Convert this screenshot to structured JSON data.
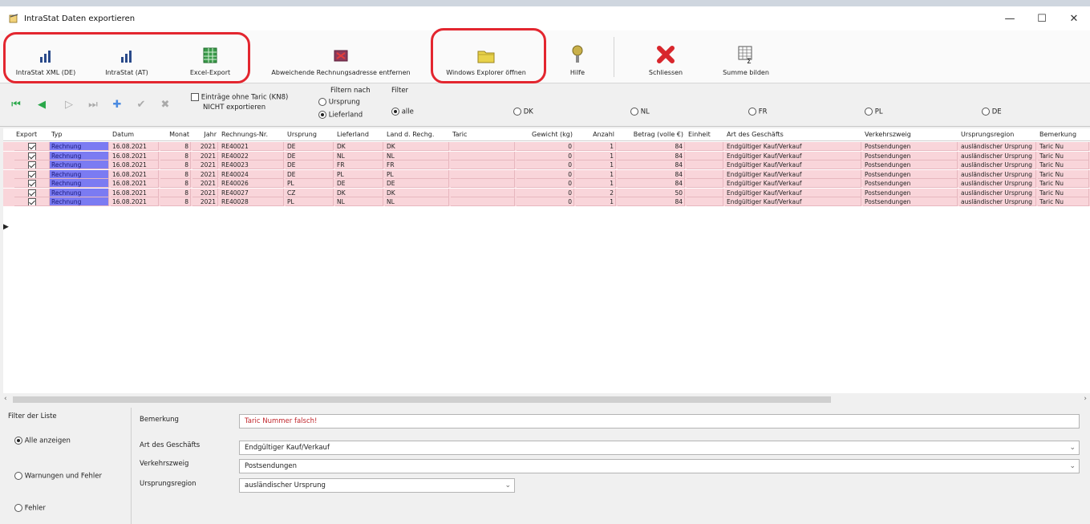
{
  "window": {
    "title": "IntraStat Daten exportieren",
    "minimize": "—",
    "maximize": "☐",
    "close": "✕"
  },
  "toolbar": {
    "buttons": [
      {
        "label": "IntraStat XML (DE)",
        "icon": "bar-chart-icon"
      },
      {
        "label": "IntraStat (AT)",
        "icon": "bar-chart-icon"
      },
      {
        "label": "Excel-Export",
        "icon": "spreadsheet-icon"
      },
      {
        "label": "Abweichende Rechnungsadresse entfernen",
        "icon": "card-remove-icon"
      },
      {
        "label": "Windows Explorer öffnen",
        "icon": "folder-icon"
      },
      {
        "label": "Hilfe",
        "icon": "help-icon"
      },
      {
        "label": "Schliessen",
        "icon": "close-icon"
      },
      {
        "label": "Summe bilden",
        "icon": "sum-table-icon"
      }
    ]
  },
  "filterbar": {
    "no_taric_line1": "Einträge ohne Taric (KN8)",
    "no_taric_line2": "NICHT exportieren",
    "filter_by_title": "Filtern nach",
    "filter_by_origin": "Ursprung",
    "filter_by_supplier": "Lieferland",
    "filter_title": "Filter",
    "countries": [
      "alle",
      "DK",
      "NL",
      "FR",
      "PL",
      "DE"
    ],
    "selected_country": "alle"
  },
  "table": {
    "columns": [
      "Export",
      "Typ",
      "Datum",
      "Monat",
      "Jahr",
      "Rechnungs-Nr.",
      "Ursprung",
      "Lieferland",
      "Land d. Rechg.",
      "Taric",
      "Gewicht (kg)",
      "Anzahl",
      "Betrag (volle €)",
      "Einheit",
      "Art des Geschäfts",
      "Verkehrszweig",
      "Ursprungsregion",
      "Bemerkung"
    ],
    "rows": [
      [
        "✓",
        "Rechnung",
        "16.08.2021",
        "8",
        "2021",
        "RE40021",
        "DE",
        "DK",
        "DK",
        "",
        "0",
        "1",
        "84",
        "",
        "Endgültiger Kauf/Verkauf",
        "Postsendungen",
        "ausländischer Ursprung",
        "Taric Nu"
      ],
      [
        "✓",
        "Rechnung",
        "16.08.2021",
        "8",
        "2021",
        "RE40022",
        "DE",
        "NL",
        "NL",
        "",
        "0",
        "1",
        "84",
        "",
        "Endgültiger Kauf/Verkauf",
        "Postsendungen",
        "ausländischer Ursprung",
        "Taric Nu"
      ],
      [
        "✓",
        "Rechnung",
        "16.08.2021",
        "8",
        "2021",
        "RE40023",
        "DE",
        "FR",
        "FR",
        "",
        "0",
        "1",
        "84",
        "",
        "Endgültiger Kauf/Verkauf",
        "Postsendungen",
        "ausländischer Ursprung",
        "Taric Nu"
      ],
      [
        "✓",
        "Rechnung",
        "16.08.2021",
        "8",
        "2021",
        "RE40024",
        "DE",
        "PL",
        "PL",
        "",
        "0",
        "1",
        "84",
        "",
        "Endgültiger Kauf/Verkauf",
        "Postsendungen",
        "ausländischer Ursprung",
        "Taric Nu"
      ],
      [
        "✓",
        "Rechnung",
        "16.08.2021",
        "8",
        "2021",
        "RE40026",
        "PL",
        "DE",
        "DE",
        "",
        "0",
        "1",
        "84",
        "",
        "Endgültiger Kauf/Verkauf",
        "Postsendungen",
        "ausländischer Ursprung",
        "Taric Nu"
      ],
      [
        "✓",
        "Rechnung",
        "16.08.2021",
        "8",
        "2021",
        "RE40027",
        "CZ",
        "DK",
        "DK",
        "",
        "0",
        "2",
        "50",
        "",
        "Endgültiger Kauf/Verkauf",
        "Postsendungen",
        "ausländischer Ursprung",
        "Taric Nu"
      ],
      [
        "✓",
        "Rechnung",
        "16.08.2021",
        "8",
        "2021",
        "RE40028",
        "PL",
        "NL",
        "NL",
        "",
        "0",
        "1",
        "84",
        "",
        "Endgültiger Kauf/Verkauf",
        "Postsendungen",
        "ausländischer Ursprung",
        "Taric Nu"
      ]
    ]
  },
  "bottom": {
    "list_filter_title": "Filter der Liste",
    "show_all": "Alle anzeigen",
    "warnings_errors": "Warnungen und Fehler",
    "errors": "Fehler",
    "remark_label": "Bemerkung",
    "remark_value": "Taric Nummer falsch!",
    "business_label": "Art des Geschäfts",
    "business_value": "Endgültiger Kauf/Verkauf",
    "transport_label": "Verkehrszweig",
    "transport_value": "Postsendungen",
    "region_label": "Ursprungsregion",
    "region_value": "ausländischer Ursprung"
  },
  "colors": {
    "row_bg": "#f9d5da",
    "type_cell": "#7b7bf2",
    "highlight_red": "#e3262f",
    "remark_text": "#c0262c"
  }
}
